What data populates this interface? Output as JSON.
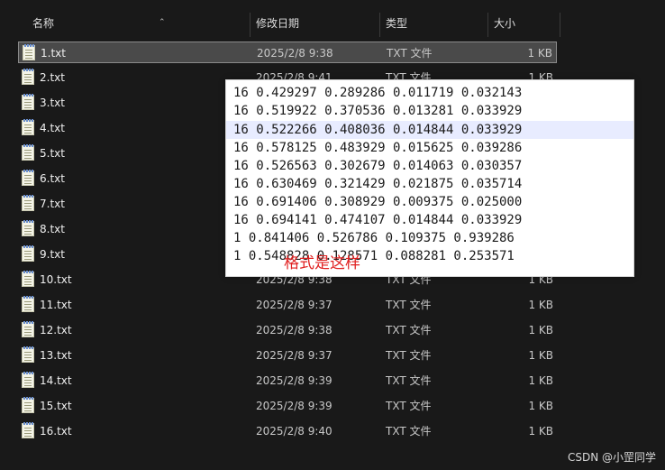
{
  "columns": {
    "name": "名称",
    "date": "修改日期",
    "type": "类型",
    "size": "大小"
  },
  "files": [
    {
      "name": "1.txt",
      "date": "2025/2/8 9:38",
      "type": "TXT 文件",
      "size": "1 KB",
      "selected": true
    },
    {
      "name": "2.txt",
      "date": "2025/2/8 9:41",
      "type": "TXT 文件",
      "size": "1 KB"
    },
    {
      "name": "3.txt",
      "date": "",
      "type": "",
      "size": ""
    },
    {
      "name": "4.txt",
      "date": "",
      "type": "",
      "size": ""
    },
    {
      "name": "5.txt",
      "date": "",
      "type": "",
      "size": ""
    },
    {
      "name": "6.txt",
      "date": "",
      "type": "",
      "size": ""
    },
    {
      "name": "7.txt",
      "date": "",
      "type": "",
      "size": ""
    },
    {
      "name": "8.txt",
      "date": "",
      "type": "",
      "size": ""
    },
    {
      "name": "9.txt",
      "date": "",
      "type": "",
      "size": ""
    },
    {
      "name": "10.txt",
      "date": "2025/2/8 9:38",
      "type": "TXT 文件",
      "size": "1 KB"
    },
    {
      "name": "11.txt",
      "date": "2025/2/8 9:37",
      "type": "TXT 文件",
      "size": "1 KB"
    },
    {
      "name": "12.txt",
      "date": "2025/2/8 9:38",
      "type": "TXT 文件",
      "size": "1 KB"
    },
    {
      "name": "13.txt",
      "date": "2025/2/8 9:37",
      "type": "TXT 文件",
      "size": "1 KB"
    },
    {
      "name": "14.txt",
      "date": "2025/2/8 9:39",
      "type": "TXT 文件",
      "size": "1 KB"
    },
    {
      "name": "15.txt",
      "date": "2025/2/8 9:39",
      "type": "TXT 文件",
      "size": "1 KB"
    },
    {
      "name": "16.txt",
      "date": "2025/2/8 9:40",
      "type": "TXT 文件",
      "size": "1 KB"
    }
  ],
  "overlay": {
    "lines": [
      "16 0.429297 0.289286 0.011719 0.032143",
      "16 0.519922 0.370536 0.013281 0.033929",
      "16 0.522266 0.408036 0.014844 0.033929",
      "16 0.578125 0.483929 0.015625 0.039286",
      "16 0.526563 0.302679 0.014063 0.030357",
      "16 0.630469 0.321429 0.021875 0.035714",
      "16 0.691406 0.308929 0.009375 0.025000",
      "16 0.694141 0.474107 0.014844 0.033929",
      "1 0.841406 0.526786 0.109375 0.939286",
      "1 0.548828 0.128571 0.088281 0.253571"
    ],
    "highlighted_line": 2,
    "note": "格式是这样"
  },
  "watermark": "CSDN @小罡同学"
}
